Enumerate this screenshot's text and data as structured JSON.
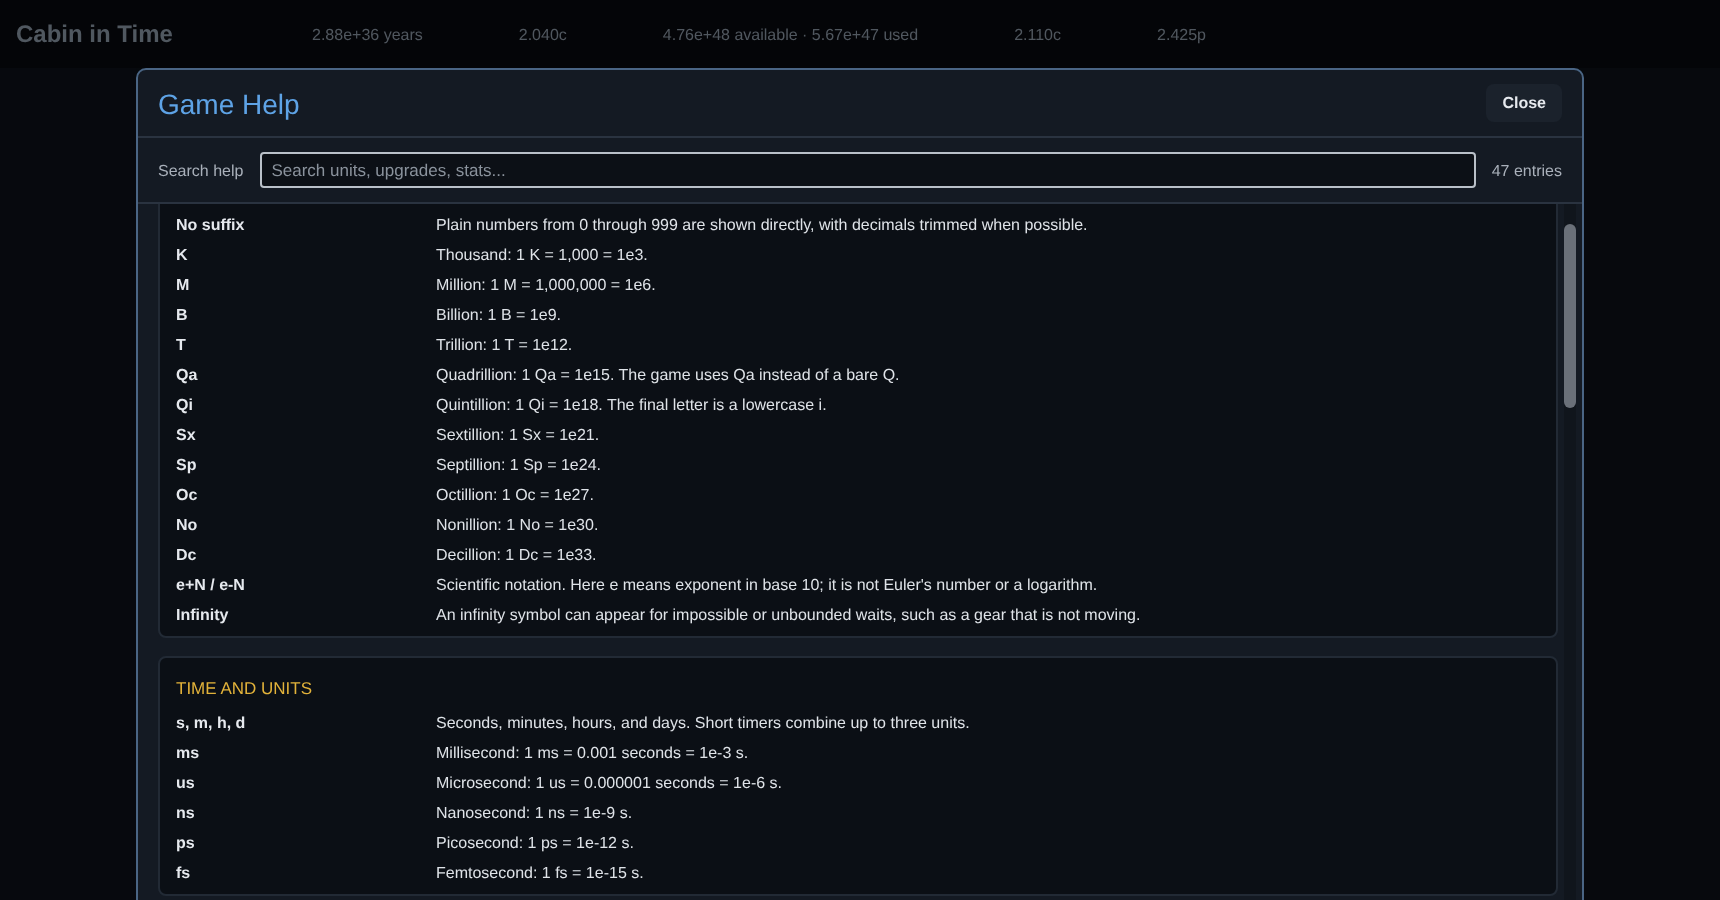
{
  "app": {
    "title": "Cabin in Time",
    "stats": [
      "2.88e+36 years",
      "2.040c",
      "4.76e+48 available · 5.67e+47 used",
      "2.110c",
      "2.425p"
    ]
  },
  "dialog": {
    "title": "Game Help",
    "close": "Close",
    "search_label": "Search help",
    "search": {
      "placeholder": "Search units, upgrades, stats..."
    },
    "count": "47 entries",
    "sections": [
      {
        "rows": [
          {
            "term": "No suffix",
            "text": "Plain numbers from 0 through 999 are shown directly, with decimals trimmed when possible."
          },
          {
            "term": "K",
            "text": "Thousand: 1 K = 1,000 = 1e3."
          },
          {
            "term": "M",
            "text": "Million: 1 M = 1,000,000 = 1e6."
          },
          {
            "term": "B",
            "text": "Billion: 1 B = 1e9."
          },
          {
            "term": "T",
            "text": "Trillion: 1 T = 1e12."
          },
          {
            "term": "Qa",
            "text": "Quadrillion: 1 Qa = 1e15. The game uses Qa instead of a bare Q."
          },
          {
            "term": "Qi",
            "text": "Quintillion: 1 Qi = 1e18. The final letter is a lowercase i."
          },
          {
            "term": "Sx",
            "text": "Sextillion: 1 Sx = 1e21."
          },
          {
            "term": "Sp",
            "text": "Septillion: 1 Sp = 1e24."
          },
          {
            "term": "Oc",
            "text": "Octillion: 1 Oc = 1e27."
          },
          {
            "term": "No",
            "text": "Nonillion: 1 No = 1e30."
          },
          {
            "term": "Dc",
            "text": "Decillion: 1 Dc = 1e33."
          },
          {
            "term": "e+N / e-N",
            "text": "Scientific notation. Here e means exponent in base 10; it is not Euler's number or a logarithm."
          },
          {
            "term": "Infinity",
            "text": "An infinity symbol can appear for impossible or unbounded waits, such as a gear that is not moving."
          }
        ]
      },
      {
        "heading": "TIME AND UNITS",
        "rows": [
          {
            "term": "s, m, h, d",
            "text": "Seconds, minutes, hours, and days. Short timers combine up to three units."
          },
          {
            "term": "ms",
            "text": "Millisecond: 1 ms = 0.001 seconds = 1e-3 s."
          },
          {
            "term": "us",
            "text": "Microsecond: 1 us = 0.000001 seconds = 1e-6 s."
          },
          {
            "term": "ns",
            "text": "Nanosecond: 1 ns = 1e-9 s."
          },
          {
            "term": "ps",
            "text": "Picosecond: 1 ps = 1e-12 s."
          },
          {
            "term": "fs",
            "text": "Femtosecond: 1 fs = 1e-15 s."
          }
        ]
      }
    ]
  }
}
